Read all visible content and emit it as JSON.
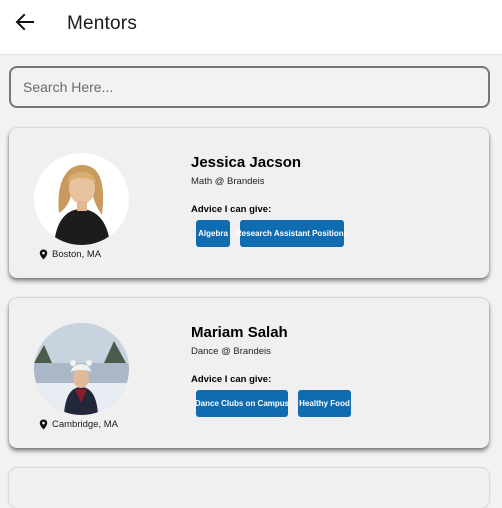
{
  "header": {
    "title": "Mentors",
    "back_icon": "arrow-left-icon"
  },
  "search": {
    "placeholder": "Search Here...",
    "value": ""
  },
  "mentors": [
    {
      "name": "Jessica Jacson",
      "role": "Math @ Brandeis",
      "advice_label": "Advice I can give:",
      "location": "Boston, MA",
      "tags": [
        "Algebra",
        "Research Assistant Positions"
      ]
    },
    {
      "name": "Mariam Salah",
      "role": "Dance @ Brandeis",
      "advice_label": "Advice I can give:",
      "location": "Cambridge, MA",
      "tags": [
        "Dance Clubs on Campus",
        "Healthy Food"
      ]
    }
  ],
  "colors": {
    "tag_bg": "#0f6cb0",
    "card_bg": "#f0f0f0",
    "page_bg": "#f2f2f2"
  }
}
